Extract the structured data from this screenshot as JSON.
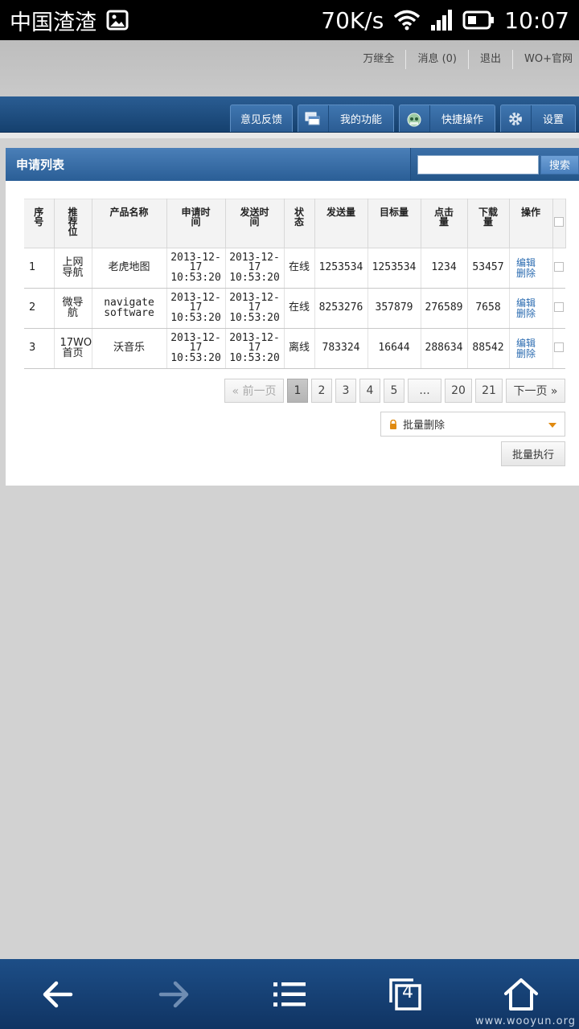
{
  "status_bar": {
    "carrier": "中国渣渣",
    "speed": "70K/s",
    "time": "10:07"
  },
  "top_links": [
    "万继全",
    "消息 (0)",
    "退出",
    "WO+官网"
  ],
  "nav": {
    "feedback": "意见反馈",
    "my_functions": "我的功能",
    "quick_ops": "快捷操作",
    "settings": "设置"
  },
  "panel": {
    "title": "申请列表",
    "search_button": "搜索",
    "search_value": ""
  },
  "table": {
    "headers": [
      "序号",
      "推荐位",
      "产品名称",
      "申请时间",
      "发送时间",
      "状态",
      "发送量",
      "目标量",
      "点击量",
      "下载量",
      "操作"
    ],
    "rows": [
      {
        "no": "1",
        "slot": "上网导航",
        "product": "老虎地图",
        "apply": "2013-12-17 10:53:20",
        "send": "2013-12-17 10:53:20",
        "status": "在线",
        "sent": "1253534",
        "target": "1253534",
        "clicks": "1234",
        "downloads": "53457",
        "edit": "编辑",
        "del": "删除"
      },
      {
        "no": "2",
        "slot": "微导航",
        "product": "navigate software",
        "apply": "2013-12-17 10:53:20",
        "send": "2013-12-17 10:53:20",
        "status": "在线",
        "sent": "8253276",
        "target": "357879",
        "clicks": "276589",
        "downloads": "7658",
        "edit": "编辑",
        "del": "删除"
      },
      {
        "no": "3",
        "slot": "17WO首页",
        "product": "沃音乐",
        "apply": "2013-12-17 10:53:20",
        "send": "2013-12-17 10:53:20",
        "status": "离线",
        "sent": "783324",
        "target": "16644",
        "clicks": "288634",
        "downloads": "88542",
        "edit": "编辑",
        "del": "删除"
      }
    ]
  },
  "pager": {
    "prev": "« 前一页",
    "pages": [
      "1",
      "2",
      "3",
      "4",
      "5",
      "...",
      "20",
      "21"
    ],
    "next": "下一页 »",
    "current": "1"
  },
  "batch": {
    "selected": "批量删除",
    "execute": "批量执行"
  },
  "browser": {
    "tab_count": "4",
    "watermark": "www.wooyun.org"
  },
  "colors": {
    "nav_blue": "#1f4f85",
    "panel_blue": "#3a6fa8",
    "link_blue": "#2a6bb0"
  }
}
